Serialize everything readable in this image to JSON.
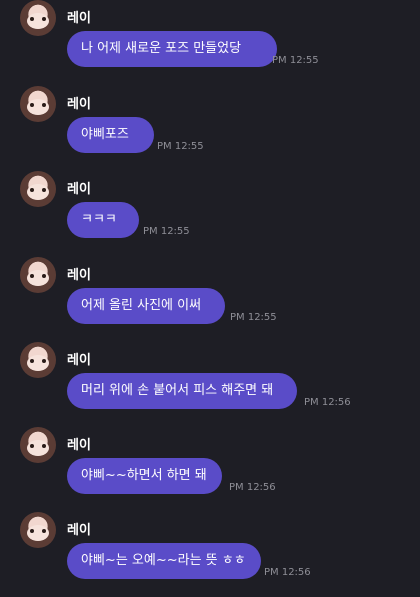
{
  "chat": {
    "messages": [
      {
        "sender": "레이",
        "text": "나 어제 새로운 포즈 만들었당",
        "time": "PM 12:55"
      },
      {
        "sender": "레이",
        "text": "야삐포즈",
        "time": "PM 12:55"
      },
      {
        "sender": "레이",
        "text": "ㅋㅋㅋ",
        "time": "PM 12:55"
      },
      {
        "sender": "레이",
        "text": "어제 올린 사진에 이써",
        "time": "PM 12:55"
      },
      {
        "sender": "레이",
        "text": "머리 위에 손 붙어서 피스 해주면 돼",
        "time": "PM 12:56"
      },
      {
        "sender": "레이",
        "text": "야삐~~하면서 하면 돼",
        "time": "PM 12:56"
      },
      {
        "sender": "레이",
        "text": "야삐~는 오예~~라는 뜻 ㅎㅎ",
        "time": "PM 12:56"
      }
    ]
  },
  "colors": {
    "background": "#1e1e25",
    "bubble": "#5a4cc8",
    "time_text": "#8e8e96",
    "name_text": "#ffffff"
  },
  "icons": {
    "avatar": "profile-photo-avatar"
  }
}
